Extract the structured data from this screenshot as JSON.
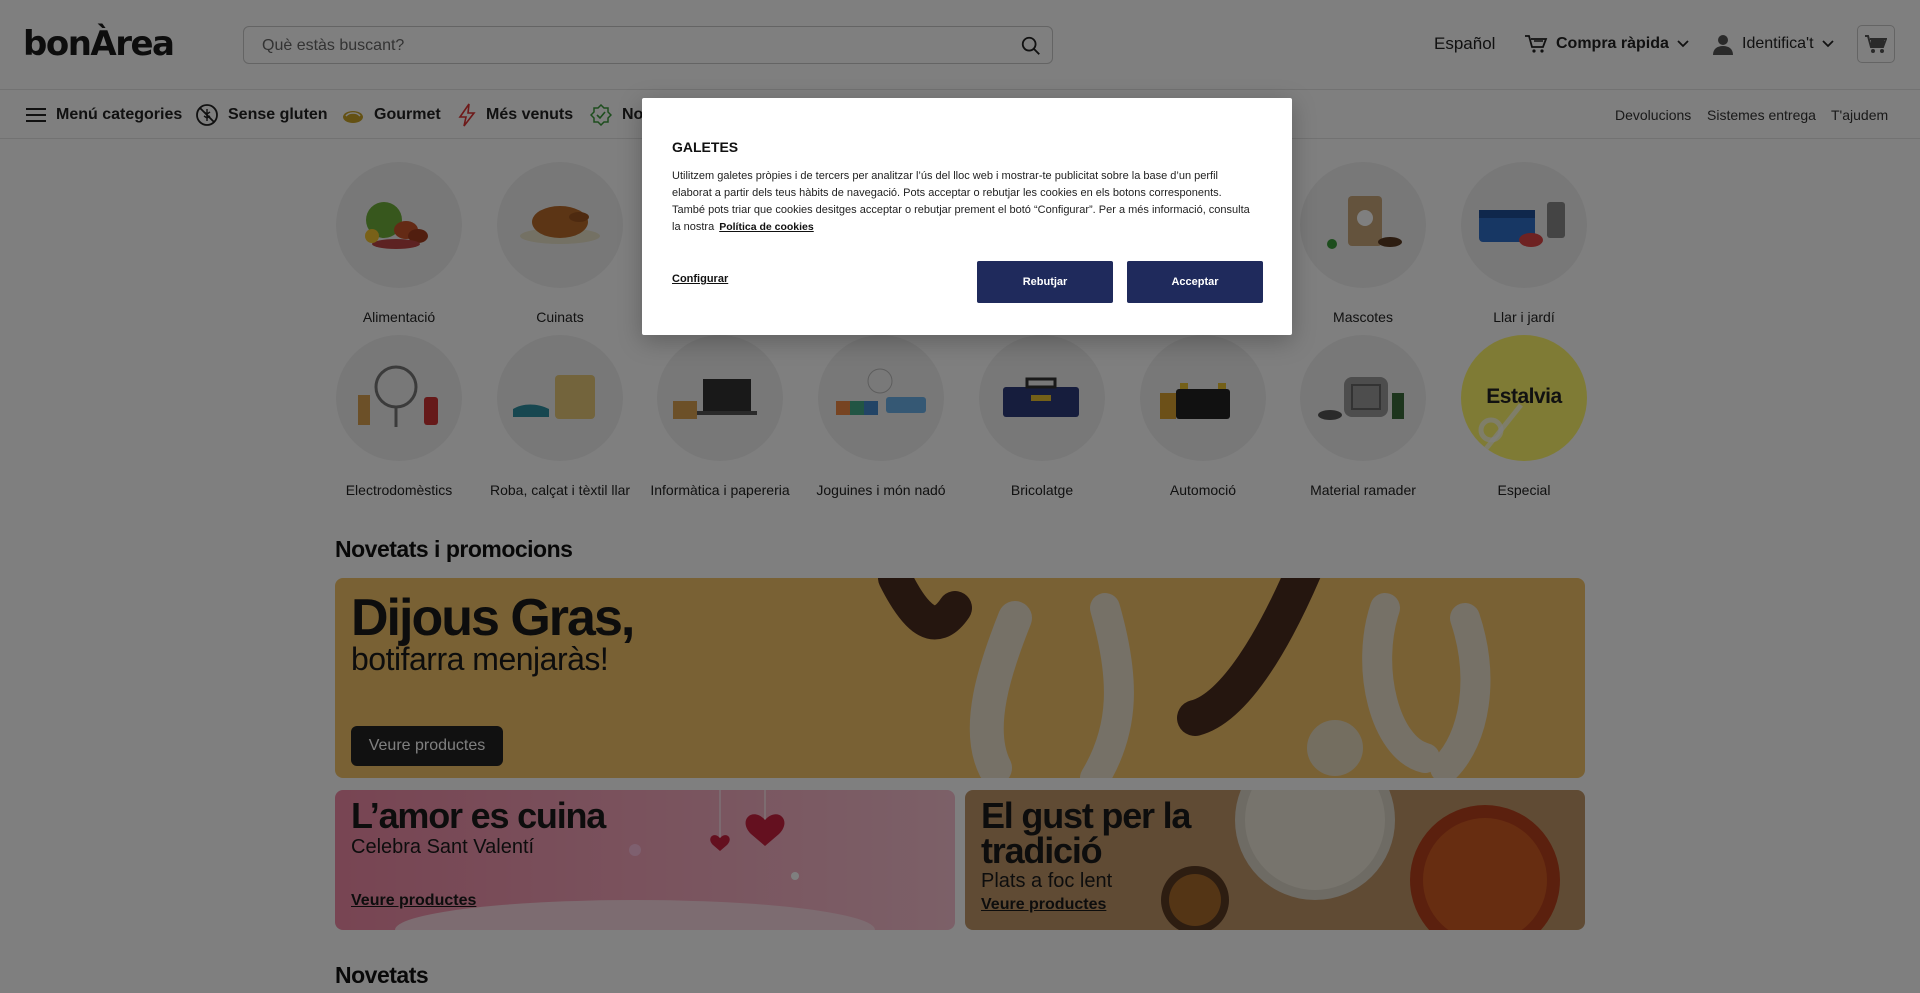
{
  "header": {
    "logo": "bonÀrea",
    "search_placeholder": "Què estàs buscant?",
    "language": "Español",
    "quick_buy": "Compra ràpida",
    "login": "Identifica't"
  },
  "category_nav": {
    "menu": "Menú categories",
    "items": [
      "Sense gluten",
      "Gourmet",
      "Més venuts",
      "No"
    ],
    "right_links": [
      "Devolucions",
      "Sistemes entrega",
      "T'ajudem"
    ]
  },
  "categories_row1": [
    "Alimentació",
    "Cuinats",
    "",
    "",
    "",
    "",
    "Mascotes",
    "Llar i jardí"
  ],
  "categories_row2": [
    "Electrodomèstics",
    "Roba, calçat i tèxtil llar",
    "Informàtica i papereria",
    "Joguines i món nadó",
    "Bricolatge",
    "Automoció",
    "Material ramader",
    "Especial"
  ],
  "special_badge": "Estalvia",
  "sections": {
    "promos_title": "Novetats i promocions",
    "news_title": "Novetats"
  },
  "banner_main": {
    "title": "Dijous Gras,",
    "subtitle": "botifarra menjaràs!",
    "button": "Veure productes"
  },
  "banner_love": {
    "title": "L’amor es cuina",
    "subtitle": "Celebra Sant Valentí",
    "link": "Veure productes"
  },
  "banner_trad": {
    "title": "El gust per la tradició",
    "subtitle": "Plats a foc lent",
    "link": "Veure productes"
  },
  "cookie_modal": {
    "title": "GALETES",
    "body": "Utilitzem galetes pròpies i de tercers per analitzar l’ús del lloc web i mostrar-te publicitat sobre la base d’un perfil elaborat a partir dels teus hàbits de navegació. Pots acceptar o rebutjar les cookies en els botons corresponents. També pots triar que cookies desitges acceptar o rebutjar prement el botó “Configurar”. Per a més informació, consulta la nostra",
    "policy_link": "Política de cookies",
    "configure": "Configurar",
    "reject": "Rebutjar",
    "accept": "Acceptar"
  },
  "colors": {
    "modal_button": "#1f2a5c",
    "banner_main_bg": "#f3c368",
    "special_circle": "#fff66b"
  }
}
